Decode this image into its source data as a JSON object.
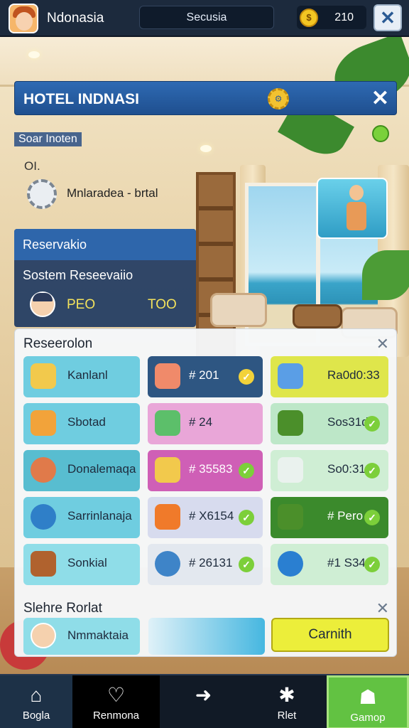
{
  "topbar": {
    "title": "Ndonasia",
    "search": "Secusia",
    "coins": "210",
    "coin_glyph": "$"
  },
  "hotel": {
    "title": "HOTEL INDNASI"
  },
  "staff": {
    "label": "Soar Inoten",
    "sub": "OI.",
    "line": "Mnlaradea - brtal"
  },
  "reservation_card": {
    "header": "Reservakio",
    "subtitle": "Sostem Reseevaiio",
    "stat_a": "PEO",
    "stat_b": "TOO"
  },
  "reservations": {
    "title": "Reseerolon",
    "tiles": [
      {
        "label": "Kanlanl",
        "col": 1,
        "row": 1,
        "bg": "#6fcde0",
        "icon": "tools-icon",
        "check": false
      },
      {
        "label": "# 201",
        "col": 2,
        "row": 1,
        "bg": "#2e5682",
        "icon": "document-icon",
        "check": true
      },
      {
        "label": "Ra0d0:33",
        "col": 3,
        "row": 1,
        "bg": "#dfe64b",
        "icon": "paint-icon",
        "check": false
      },
      {
        "label": "Sbotad",
        "col": 1,
        "row": 2,
        "bg": "#6fcde0",
        "icon": "beach-icon",
        "check": false
      },
      {
        "label": "# 24",
        "col": 2,
        "row": 2,
        "bg": "#e9a6d8",
        "icon": "map-icon",
        "check": false
      },
      {
        "label": "Sos31d",
        "col": 3,
        "row": 2,
        "bg": "#bde7c8",
        "icon": "gear-icon",
        "check": true
      },
      {
        "label": "Donalemaqa",
        "col": 1,
        "row": 3,
        "bg": "#58bdd0",
        "icon": "face-icon",
        "check": false
      },
      {
        "label": "# 35583",
        "col": 2,
        "row": 3,
        "bg": "#cf5fb6",
        "icon": "clock-icon",
        "check": true
      },
      {
        "label": "So0:31",
        "col": 3,
        "row": 3,
        "bg": "#cfeed4",
        "icon": "jar-icon",
        "check": true
      },
      {
        "label": "Sarrinlanaja",
        "col": 1,
        "row": 4,
        "bg": "#6fcde0",
        "icon": "globe-icon",
        "check": false
      },
      {
        "label": "# X6154",
        "col": 2,
        "row": 4,
        "bg": "#d7dbee",
        "icon": "sun-icon",
        "check": true
      },
      {
        "label": "# Pero",
        "col": 3,
        "row": 4,
        "bg": "#3b8a2c",
        "icon": "gear-icon",
        "check": true
      },
      {
        "label": "Sonkial",
        "col": 1,
        "row": 5,
        "bg": "#8fdde8",
        "icon": "horse-icon",
        "check": false
      },
      {
        "label": "# 26131",
        "col": 2,
        "row": 5,
        "bg": "#e3e8ef",
        "icon": "compass-icon",
        "check": true
      },
      {
        "label": "#1 S34",
        "col": 3,
        "row": 5,
        "bg": "#cfeed4",
        "icon": "info-icon",
        "check": true
      }
    ]
  },
  "staff_section": {
    "title": "Slehre Rorlat",
    "member": "Nmmaktaia",
    "action": "Carnith"
  },
  "nav": [
    {
      "label": "Bogla",
      "icon": "home-icon",
      "glyph": "⌂"
    },
    {
      "label": "Renmona",
      "icon": "shield-icon",
      "glyph": "♡"
    },
    {
      "label": "",
      "icon": "arrow-icon",
      "glyph": "➜"
    },
    {
      "label": "Rlet",
      "icon": "gear-icon",
      "glyph": "✱"
    },
    {
      "label": "Gamop",
      "icon": "robot-icon",
      "glyph": "☗"
    }
  ]
}
